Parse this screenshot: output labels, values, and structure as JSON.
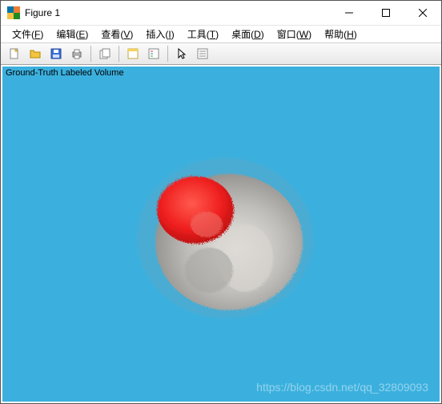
{
  "window": {
    "title": "Figure 1"
  },
  "menus": {
    "file": {
      "label": "文件(",
      "hot": "F",
      "tail": ")"
    },
    "edit": {
      "label": "编辑(",
      "hot": "E",
      "tail": ")"
    },
    "view": {
      "label": "查看(",
      "hot": "V",
      "tail": ")"
    },
    "insert": {
      "label": "插入(",
      "hot": "I",
      "tail": ")"
    },
    "tools": {
      "label": "工具(",
      "hot": "T",
      "tail": ")"
    },
    "desktop": {
      "label": "桌面(",
      "hot": "D",
      "tail": ")"
    },
    "window": {
      "label": "窗口(",
      "hot": "W",
      "tail": ")"
    },
    "help": {
      "label": "帮助(",
      "hot": "H",
      "tail": ")"
    }
  },
  "plot": {
    "caption": "Ground-Truth Labeled Volume",
    "bg_color": "#3bb0de",
    "label_color": "#ef1f1f",
    "tissue_color": "#b9b7b4"
  },
  "watermark": "https://blog.csdn.net/qq_32809093",
  "icons": {
    "new": "new-file-icon",
    "open": "open-folder-icon",
    "save": "save-icon",
    "print": "print-icon",
    "copy": "copy-figure-icon",
    "layout": "layout-icon",
    "legend": "legend-icon",
    "pointer": "pointer-icon",
    "datacursor": "data-cursor-icon"
  }
}
